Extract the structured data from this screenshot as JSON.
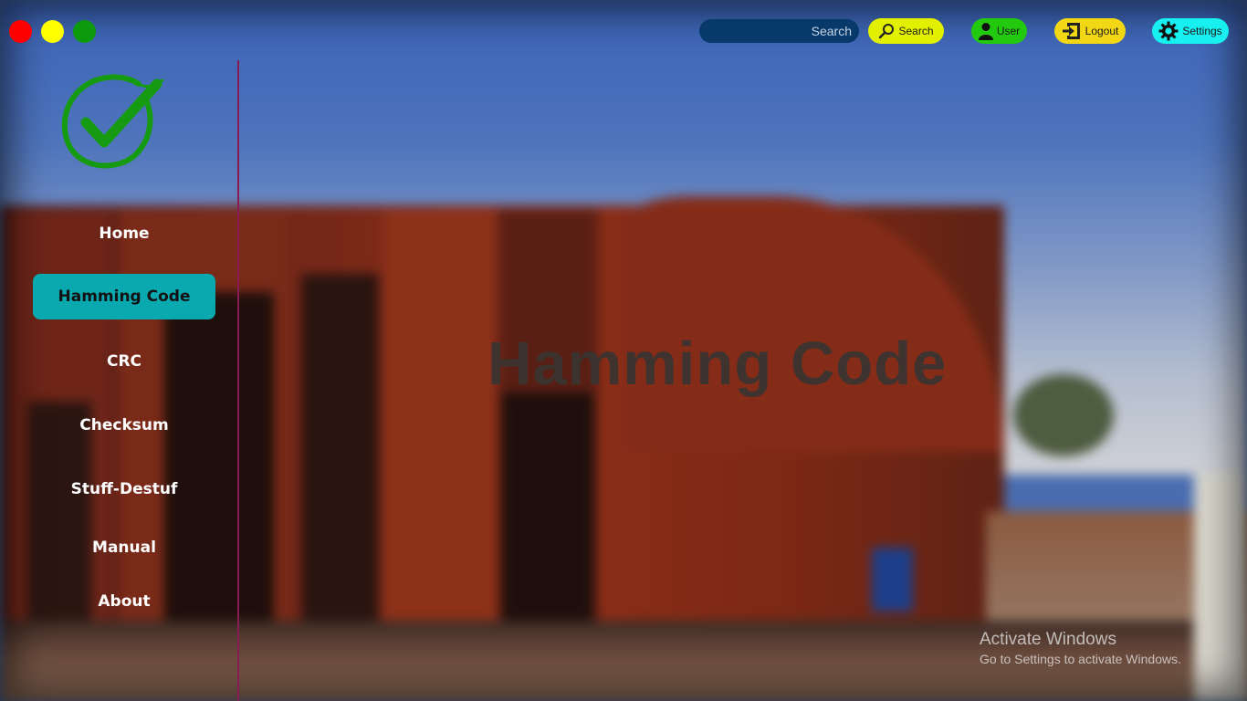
{
  "window_controls": {
    "close_color": "#ff0000",
    "minimize_color": "#ffff00",
    "maximize_color": "#0c9a0c"
  },
  "topbar": {
    "search_placeholder": "Search",
    "search_button_label": "Search",
    "search_button_icon": "magnifier-icon",
    "user_button_label": "User",
    "user_button_icon": "person-icon",
    "logout_button_label": "Logout",
    "logout_button_icon": "logout-arrow-icon",
    "settings_button_label": "Settings",
    "settings_button_icon": "gear-icon",
    "colors": {
      "search_input": "#073a6a",
      "search_button": "#e2f000",
      "user_button": "#22c90f",
      "logout_button": "#f2d814",
      "settings_button": "#18f0f0"
    }
  },
  "sidebar": {
    "logo_icon": "green-checkmark-logo",
    "active_color": "#0aa9b0",
    "items": [
      {
        "label": "Home",
        "active": false
      },
      {
        "label": "Hamming Code",
        "active": true
      },
      {
        "label": "CRC",
        "active": false
      },
      {
        "label": "Checksum",
        "active": false
      },
      {
        "label": "Stuff-Destuf",
        "active": false
      },
      {
        "label": "Manual",
        "active": false
      },
      {
        "label": "About",
        "active": false
      }
    ]
  },
  "main": {
    "heading": "Hamming Code"
  },
  "watermark": {
    "title": "Activate Windows",
    "subtitle": "Go to Settings to activate Windows."
  }
}
